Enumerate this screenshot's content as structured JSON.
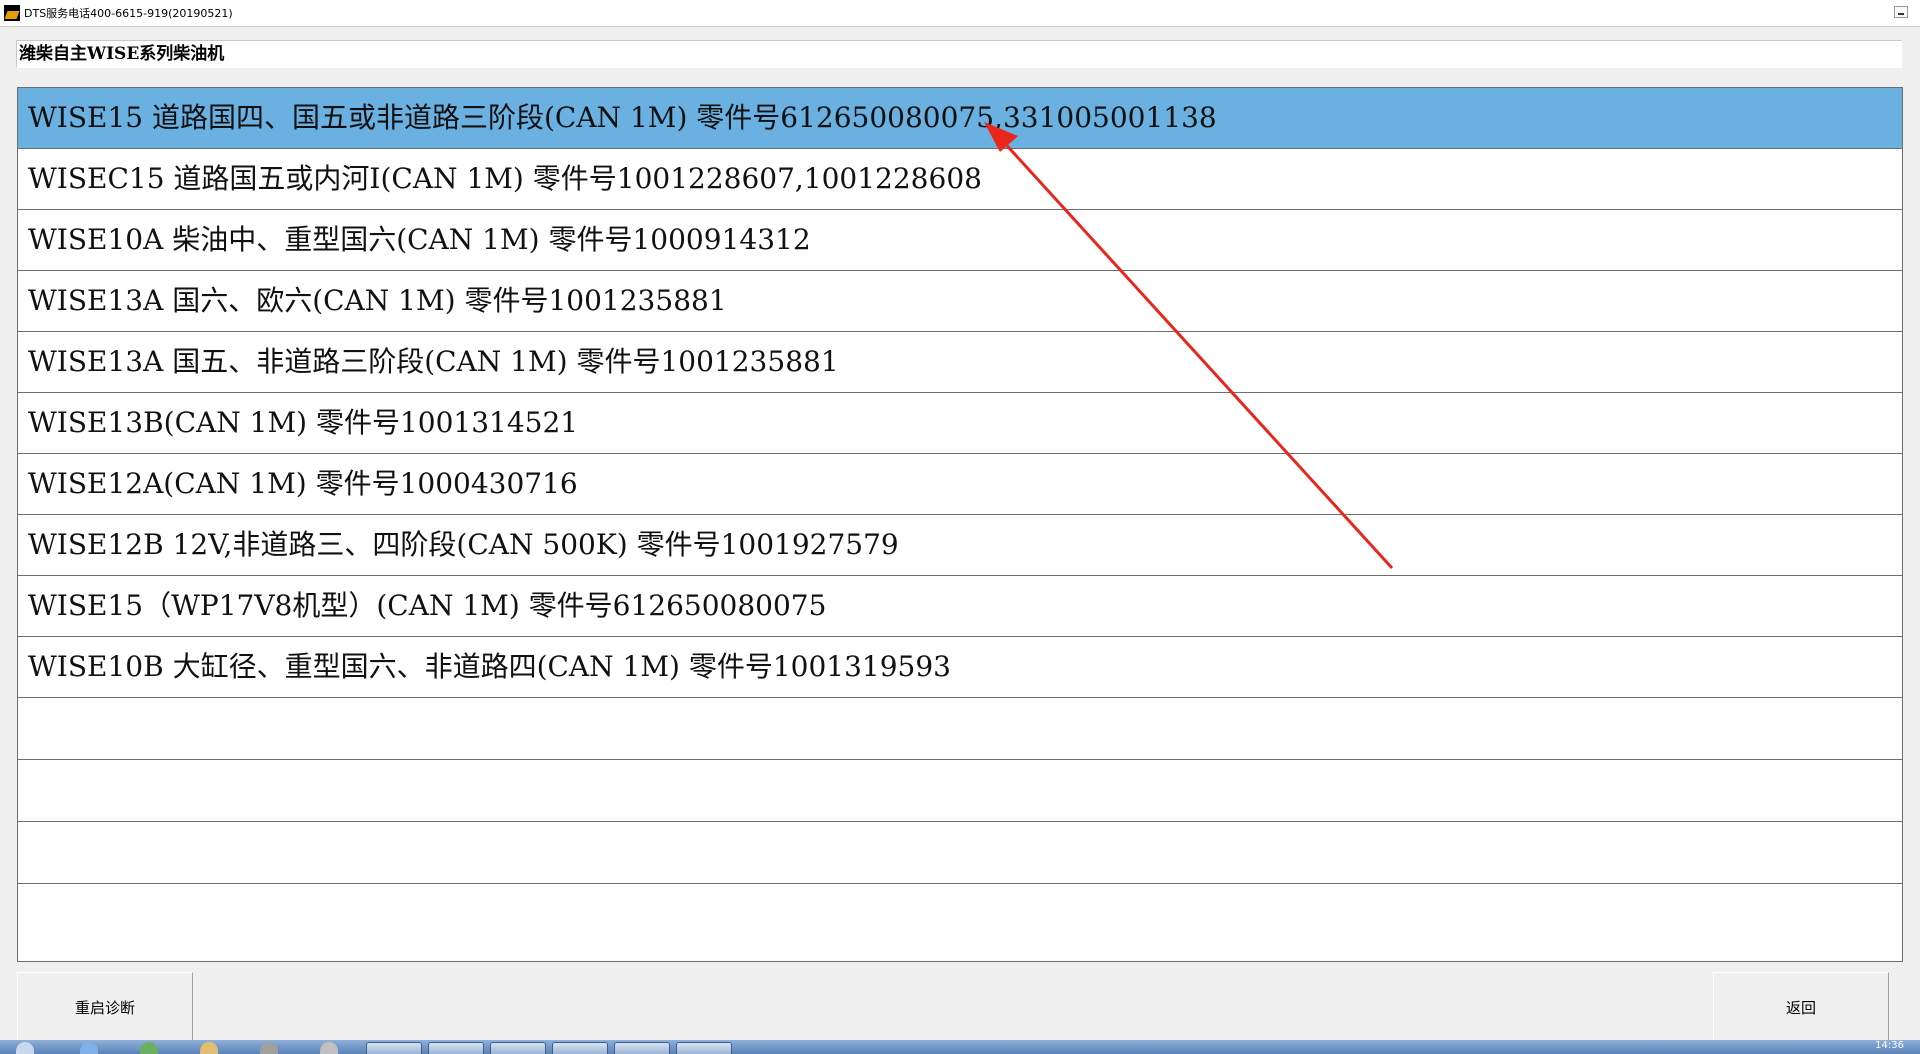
{
  "window": {
    "title": "DTS服务电话400-6615-919(20190521)"
  },
  "header": {
    "title": "潍柴自主WISE系列柴油机"
  },
  "list": {
    "items": [
      "WISE15 道路国四、国五或非道路三阶段(CAN 1M) 零件号612650080075,331005001138",
      "WISEC15 道路国五或内河I(CAN 1M) 零件号1001228607,1001228608",
      "WISE10A 柴油中、重型国六(CAN 1M) 零件号1000914312",
      "WISE13A 国六、欧六(CAN 1M) 零件号1001235881",
      "WISE13A 国五、非道路三阶段(CAN 1M) 零件号1001235881",
      "WISE13B(CAN 1M) 零件号1001314521",
      "WISE12A(CAN 1M) 零件号1000430716",
      "WISE12B 12V,非道路三、四阶段(CAN 500K) 零件号1001927579",
      "WISE15（WP17V8机型）(CAN 1M) 零件号612650080075",
      "WISE10B 大缸径、重型国六、非道路四(CAN 1M) 零件号1001319593"
    ],
    "selected_index": 0,
    "selected_color": "#6ab0e0"
  },
  "buttons": {
    "restart_label": "重启诊断",
    "back_label": "返回"
  },
  "taskbar": {
    "clock": "14:36"
  },
  "annotation": {
    "arrow_color": "#e8261c"
  }
}
